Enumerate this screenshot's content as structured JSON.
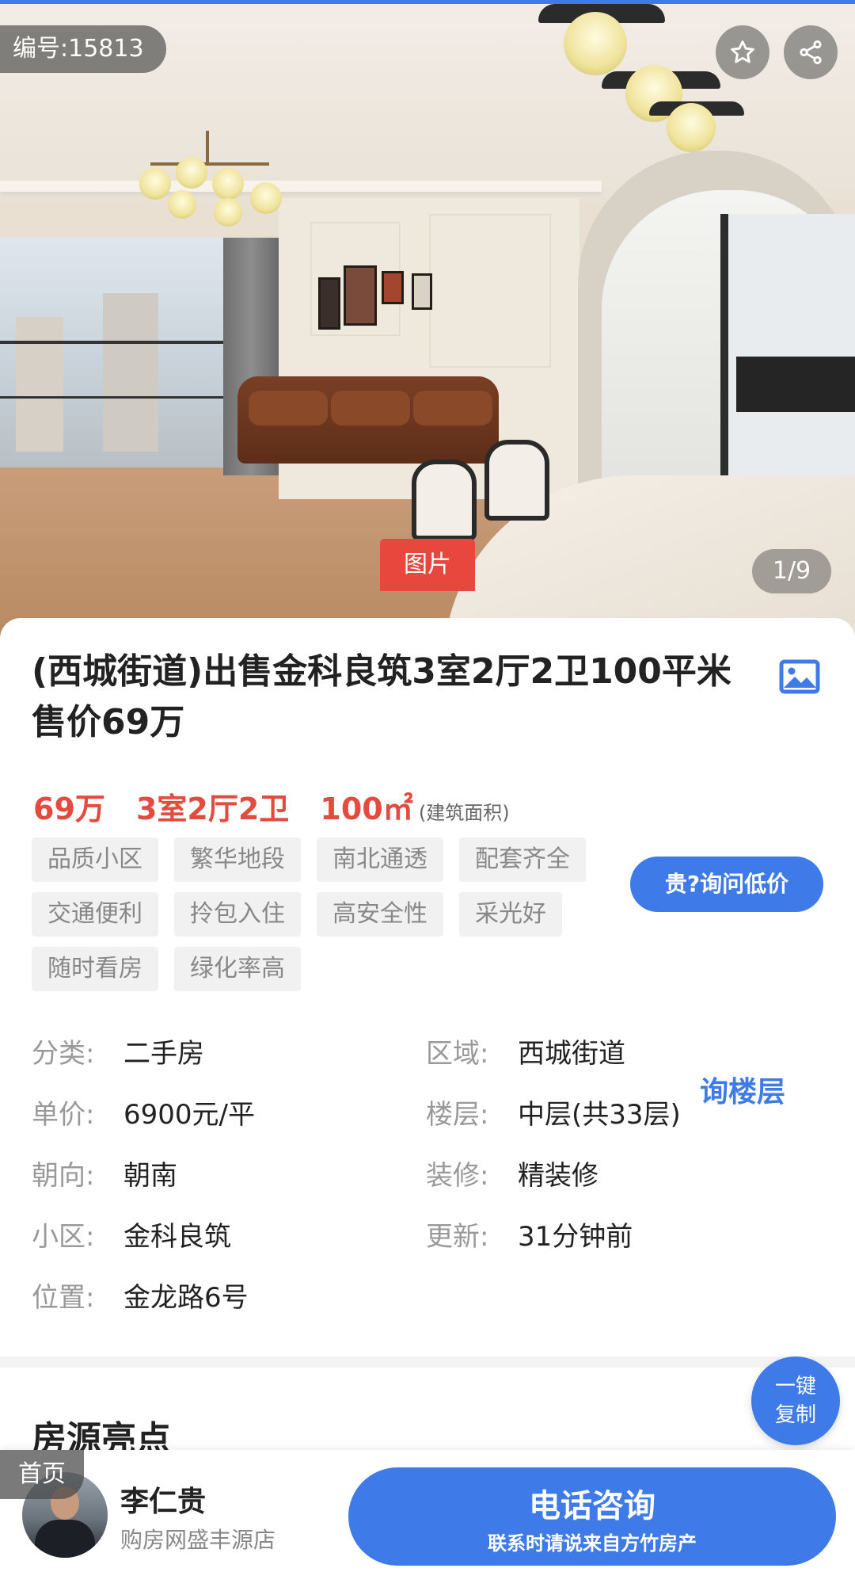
{
  "gallery": {
    "listing_id": "编号:15813",
    "image_tag": "图片",
    "counter": "1/9"
  },
  "listing": {
    "title": "(西城街道)出售金科良筑3室2厅2卫100平米 售价69万",
    "price": "69万",
    "layout": "3室2厅2卫",
    "area": "100㎡",
    "area_note": "(建筑面积)",
    "tags": [
      "品质小区",
      "繁华地段",
      "南北通透",
      "配套齐全",
      "交通便利",
      "拎包入住",
      "高安全性",
      "采光好",
      "随时看房",
      "绿化率高"
    ],
    "ask_price_button": "贵?询问低价"
  },
  "details": [
    {
      "key": "分类:",
      "value": "二手房"
    },
    {
      "key": "区域:",
      "value": "西城街道"
    },
    {
      "key": "单价:",
      "value": "6900元/平"
    },
    {
      "key": "楼层:",
      "value": "中层(共33层)"
    },
    {
      "key": "朝向:",
      "value": "朝南"
    },
    {
      "key": "装修:",
      "value": "精装修"
    },
    {
      "key": "小区:",
      "value": "金科良筑"
    },
    {
      "key": "更新:",
      "value": "31分钟前"
    },
    {
      "key": "位置:",
      "value": "金龙路6号"
    }
  ],
  "ask_floor_link": "询楼层",
  "copy_button": {
    "line1": "一键",
    "line2": "复制"
  },
  "section_title": "房源亮点",
  "bottom_bar": {
    "home_tag": "首页",
    "agent_name": "李仁贵",
    "agent_store": "购房网盛丰源店",
    "call_label": "电话咨询",
    "call_sub": "联系时请说来自方竹房产"
  },
  "icons": {
    "favorite": "star-icon",
    "share": "share-icon",
    "gallery": "image-icon"
  },
  "colors": {
    "accent": "#3f7be8",
    "price": "#e34b3f",
    "image_tag": "#e8473e"
  }
}
